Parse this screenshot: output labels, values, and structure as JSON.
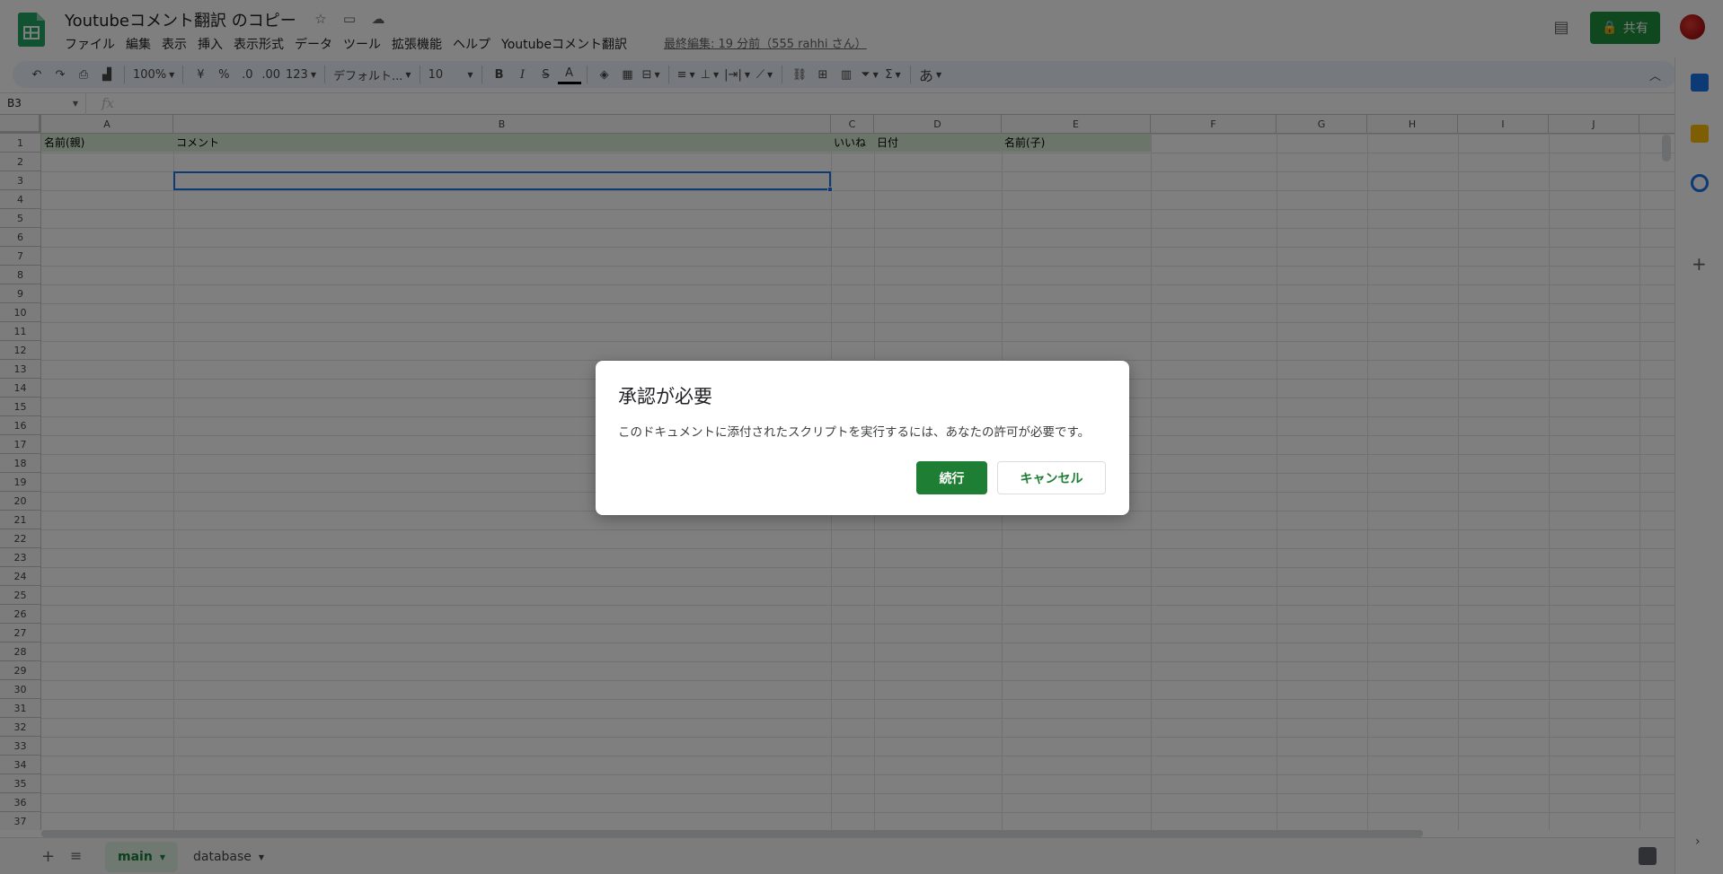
{
  "app": {
    "doc_title": "Youtubeコメント翻訳 のコピー",
    "last_edit": "最終編集: 19 分前（555 rahhi さん）",
    "share_label": "共有"
  },
  "menu": [
    "ファイル",
    "編集",
    "表示",
    "挿入",
    "表示形式",
    "データ",
    "ツール",
    "拡張機能",
    "ヘルプ",
    "Youtubeコメント翻訳"
  ],
  "toolbar": {
    "zoom": "100%",
    "currency": "¥",
    "percent": "%",
    "dec_decrease": ".0",
    "dec_increase": ".00",
    "number_format": "123",
    "font": "デフォルト...",
    "font_size": "10",
    "bold": "B",
    "italic": "I",
    "strike": "S",
    "text_color": "A",
    "input_tools": "あ"
  },
  "formula_bar": {
    "name_box": "B3",
    "fx": "fx"
  },
  "columns": [
    "A",
    "B",
    "C",
    "D",
    "E",
    "F",
    "G",
    "H",
    "I",
    "J"
  ],
  "rows": [
    "1",
    "2",
    "3",
    "4",
    "5",
    "6",
    "7",
    "8",
    "9",
    "10",
    "11",
    "12",
    "13",
    "14",
    "15",
    "16",
    "17",
    "18",
    "19",
    "20",
    "21",
    "22",
    "23",
    "24",
    "25",
    "26",
    "27",
    "28",
    "29",
    "30",
    "31",
    "32",
    "33",
    "34",
    "35",
    "36",
    "37"
  ],
  "header_cells": {
    "a1": "名前(親)",
    "b1": "コメント",
    "c1": "いいね",
    "d1": "日付",
    "e1": "名前(子)"
  },
  "sheets": [
    {
      "label": "main",
      "active": true
    },
    {
      "label": "database",
      "active": false
    }
  ],
  "dialog": {
    "title": "承認が必要",
    "body": "このドキュメントに添付されたスクリプトを実行するには、あなたの許可が必要です。",
    "continue_label": "続行",
    "cancel_label": "キャンセル"
  },
  "colors": {
    "accent_green": "#1e8e3e",
    "header_row_fill": "#d9ead3",
    "selection_blue": "#1a73e8"
  }
}
